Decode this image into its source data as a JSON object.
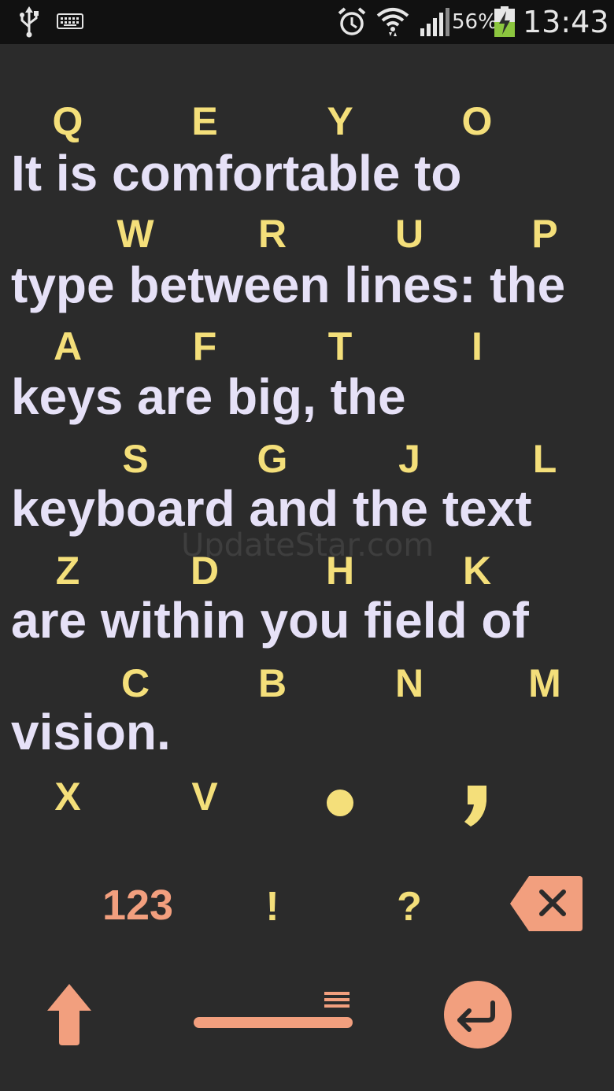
{
  "status_bar": {
    "battery": "56%",
    "time": "13:43",
    "icons": [
      "usb-icon",
      "keyboard-icon",
      "alarm-icon",
      "wifi-icon",
      "signal-icon",
      "battery-charging-icon"
    ]
  },
  "colors": {
    "background": "#2b2b2b",
    "key_letter": "#f4df7a",
    "typed_text": "#e6e1f7",
    "accent": "#f29f7e"
  },
  "keyboard_rows": [
    [
      "Q",
      "E",
      "Y",
      "O"
    ],
    [
      "W",
      "R",
      "U",
      "P"
    ],
    [
      "A",
      "F",
      "T",
      "I"
    ],
    [
      "S",
      "G",
      "J",
      "L"
    ],
    [
      "Z",
      "D",
      "H",
      "K"
    ],
    [
      "C",
      "B",
      "N",
      "M"
    ],
    [
      "X",
      "V"
    ]
  ],
  "punctuation_row": [
    "dot-key",
    "comma-key"
  ],
  "typed_text": [
    "It is comfortable to",
    "type between lines: the",
    "keys are big, the",
    "keyboard and the text",
    "are within you field of",
    "vision."
  ],
  "watermark": "UpdateStar.com",
  "function_row": {
    "numbers_label": "123",
    "exclaim_label": "!",
    "question_label": "?"
  },
  "bottom_row": {
    "icons": [
      "shift-arrow-icon",
      "space-bar-menu-icon",
      "enter-icon"
    ]
  }
}
